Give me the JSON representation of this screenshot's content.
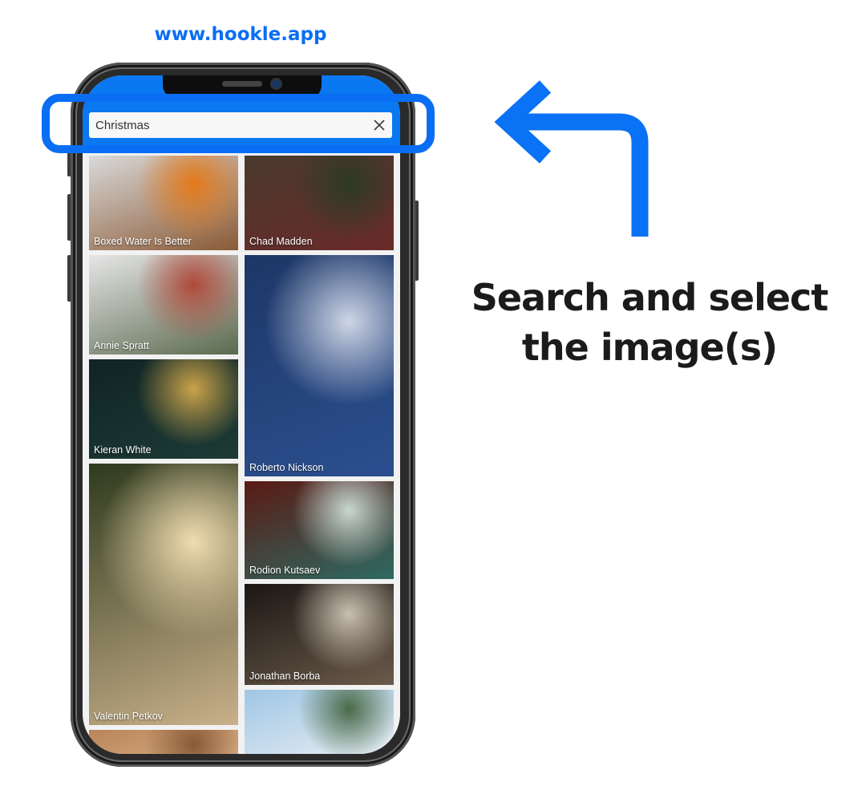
{
  "site_url": "www.hookle.app",
  "search": {
    "value": "Christmas",
    "clear_icon": "close-icon"
  },
  "images": [
    {
      "author": "Boxed Water Is Better",
      "column": "left",
      "colors": [
        "#d9d9d9",
        "#8a5a36",
        "#e37a1a"
      ]
    },
    {
      "author": "Chad Madden",
      "column": "right",
      "colors": [
        "#4a3a2e",
        "#6a2a2a",
        "#2c3a24"
      ]
    },
    {
      "author": "Annie Spratt",
      "column": "left",
      "colors": [
        "#e6e6e6",
        "#5b6a4f",
        "#b04a3a"
      ]
    },
    {
      "author": "Roberto Nickson",
      "column": "right",
      "colors": [
        "#1d3766",
        "#2b4f8f",
        "#cfd6e6"
      ]
    },
    {
      "author": "Kieran White",
      "column": "left",
      "colors": [
        "#0f2424",
        "#1e3b36",
        "#caa34a"
      ]
    },
    {
      "author": "Rodion Kutsaev",
      "column": "right",
      "colors": [
        "#5a1a14",
        "#2e6a62",
        "#c7d7d0"
      ]
    },
    {
      "author": "Valentin Petkov",
      "column": "left",
      "colors": [
        "#2e3a1e",
        "#c9b08a",
        "#f0dcb0"
      ]
    },
    {
      "author": "Jonathan Borba",
      "column": "right",
      "colors": [
        "#1c1714",
        "#6a5a4a",
        "#c9bfb0"
      ]
    },
    {
      "author": "",
      "column": "left",
      "colors": [
        "#b9855a",
        "#e0b890",
        "#8a5a36"
      ]
    },
    {
      "author": "",
      "column": "right",
      "colors": [
        "#9fc6e6",
        "#e8eef2",
        "#4a6a48"
      ]
    }
  ],
  "annotation": {
    "arrow_icon": "arrow-up-left-icon",
    "line1": "Search and select",
    "line2": "the image(s)",
    "accent_color": "#0a6ef5"
  }
}
